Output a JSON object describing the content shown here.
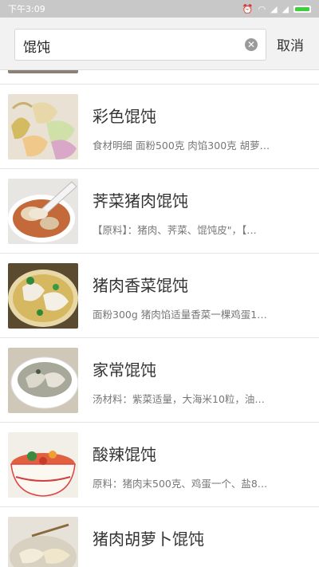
{
  "status_bar": {
    "time": "下午3:09",
    "icons": [
      "alarm-icon",
      "wifi-icon",
      "signal-icon",
      "signal-icon",
      "battery-icon"
    ],
    "battery_percent": 100
  },
  "search": {
    "query": "馄饨",
    "placeholder": "",
    "cancel_label": "取消"
  },
  "results": [
    {
      "title": "彩色馄饨",
      "desc": "食材明细 面粉500克 肉馅300克 胡萝…",
      "image": "colorful-wonton"
    },
    {
      "title": "荠菜猪肉馄饨",
      "desc": "【原料】：猪肉、荠菜、馄饨皮\"，【…",
      "image": "wonton-soup-bowl"
    },
    {
      "title": "猪肉香菜馄饨",
      "desc": "面粉300g 猪肉馅适量香菜一棵鸡蛋1…",
      "image": "wonton-cilantro"
    },
    {
      "title": "家常馄饨",
      "desc": "汤材料：紫菜适量，大海米10粒，油…",
      "image": "wonton-plate"
    },
    {
      "title": "酸辣馄饨",
      "desc": "原料：猪肉末500克、鸡蛋一个、盐8…",
      "image": "spicy-wonton"
    },
    {
      "title": "猪肉胡萝卜馄饨",
      "desc": "",
      "image": "wonton-carrot"
    }
  ]
}
